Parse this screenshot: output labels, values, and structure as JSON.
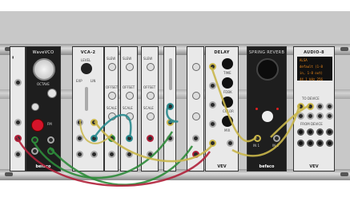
{
  "modules": {
    "vco": {
      "name": "WaveVCO",
      "knob_label": "OCTAVE",
      "fm_label": "FM",
      "brand": "befaco"
    },
    "vca": {
      "name": "VCA-2",
      "level_label": "LEVEL",
      "exp_label": "EXP",
      "lin_label": "LIN"
    },
    "env1": {
      "labels": [
        "SLEW",
        "OFFSET",
        "SCALE",
        "OUT"
      ]
    },
    "env2": {
      "labels": [
        "SLEW",
        "OFFSET",
        "SCALE",
        "OUT"
      ]
    },
    "scope": {
      "labels": [
        "SLEW",
        "OFFSET",
        "SCALE"
      ]
    },
    "delay": {
      "name": "DELAY",
      "knobs": [
        "TIME",
        "FDBK",
        "COLOR",
        "MIX"
      ],
      "brand": "VEV"
    },
    "reverb": {
      "name": "SPRING REVERB",
      "inputs": [
        "IN 1",
        "IN 2"
      ],
      "brand": "befaco"
    },
    "audio": {
      "name": "AUDIO-8",
      "screen_lines": [
        "ALSA",
        "default (1-8 in, 1-8 out)",
        "44.1 kHz  256"
      ],
      "to_device": "TO DEVICE",
      "from_device": "FROM DEVICE",
      "brand": "VEV"
    }
  },
  "colors": {
    "cable_green": "#2e8b3a",
    "cable_red": "#b0213a",
    "cable_yellow": "#c9b64a",
    "cable_teal": "#2a8a8e",
    "accent_orange": "#f08a1a"
  }
}
